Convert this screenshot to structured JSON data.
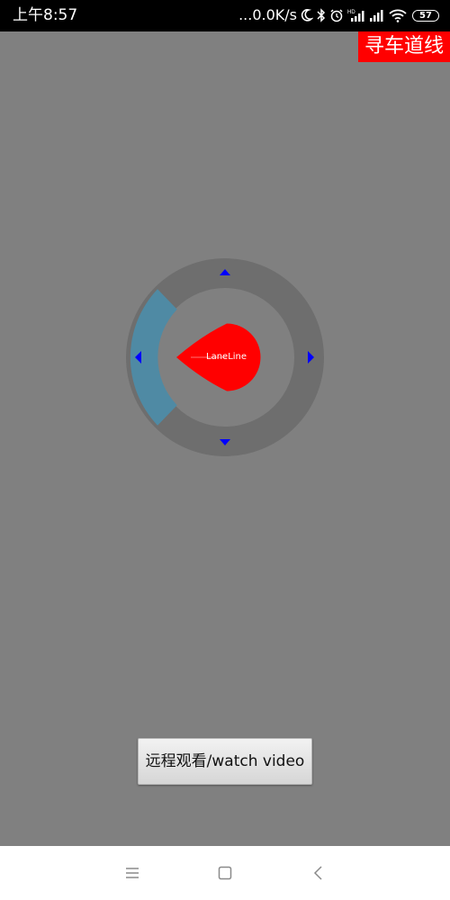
{
  "status_bar": {
    "time": "上午8:57",
    "net_speed": "...0.0K/s",
    "battery_level": "57",
    "icons": [
      "moon-icon",
      "bluetooth-icon",
      "alarm-icon",
      "hd-signal-icon",
      "signal-icon",
      "wifi-icon",
      "battery-icon"
    ]
  },
  "top_button": {
    "label": "寻车道线",
    "color": "#ff0000"
  },
  "joystick": {
    "center_label": "LaneLine",
    "active_direction": "left",
    "colors": {
      "ring": "#6e6e6e",
      "highlight": "#4f8aa4",
      "knob": "#ff0000",
      "arrows": "#0000ff"
    },
    "arrows": [
      "arrow-up-icon",
      "arrow-right-icon",
      "arrow-down-icon",
      "arrow-left-icon"
    ]
  },
  "watch_button": {
    "label": "远程观看/watch video"
  },
  "nav_bar": {
    "icons": [
      "menu-icon",
      "home-icon",
      "back-icon"
    ]
  }
}
